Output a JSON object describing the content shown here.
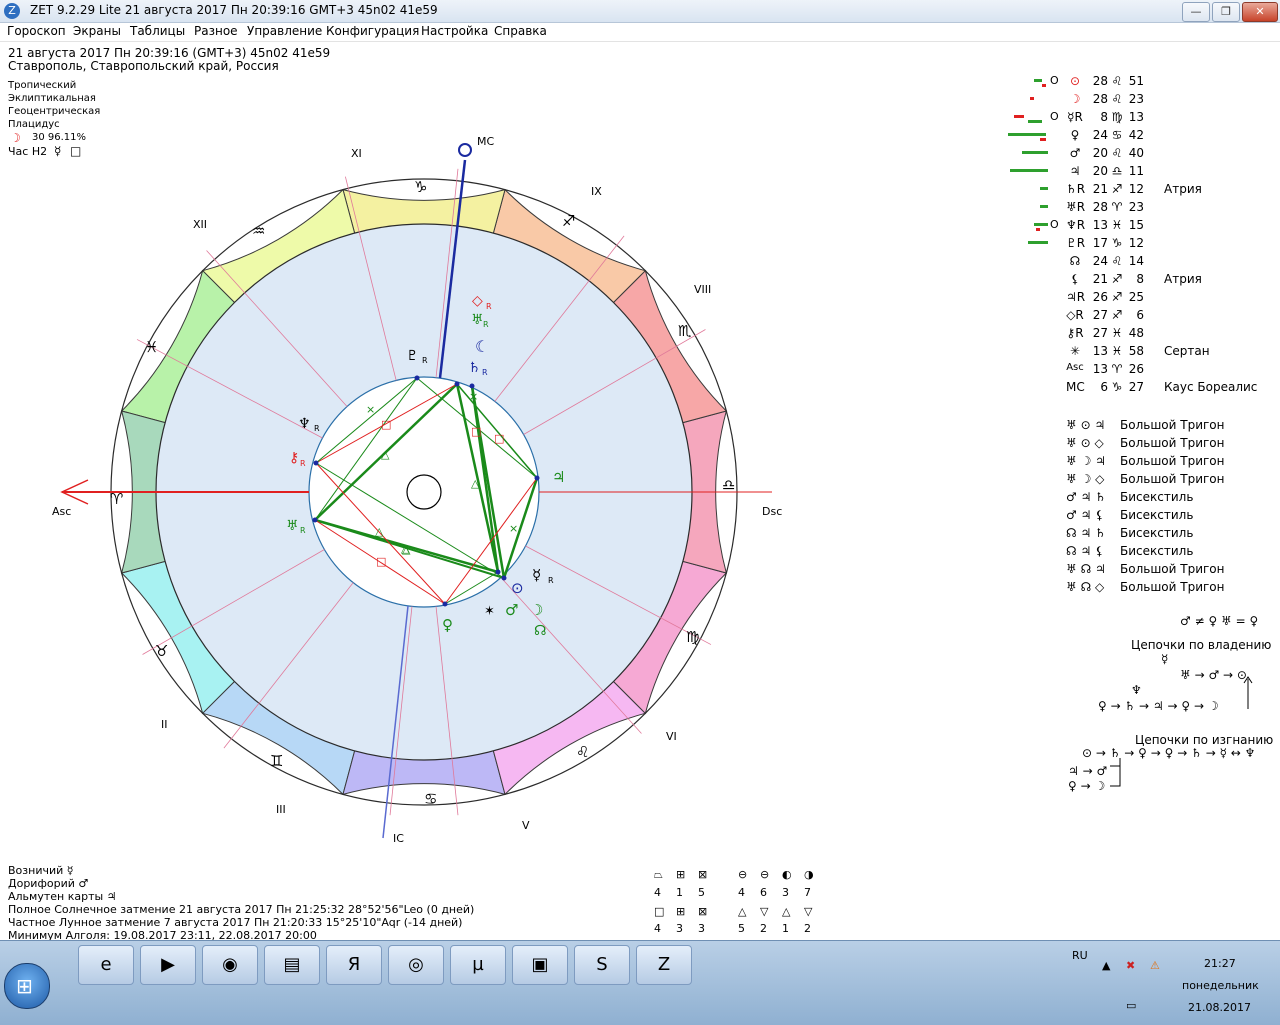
{
  "window": {
    "title": "ZET 9.2.29 Lite   21 августа 2017   Пн  20:39:16 GMT+3 45n02  41e59",
    "minimize": "—",
    "restore": "❐",
    "close": "✕"
  },
  "menu": [
    "Гороскоп",
    "Экраны",
    "Таблицы",
    "Разное",
    "Управление",
    "Конфигурация",
    "Настройка",
    "Справка"
  ],
  "header": {
    "datetime": "21 августа 2017  Пн  20:39:16 (GMT+3)  45n02  41e59",
    "place": "Ставрополь, Ставропольский край, Россия",
    "mode1": "Тропический",
    "mode2": "Эклиптикальная",
    "mode3": "Геоцентрическая",
    "mode4": "Плацидус",
    "moon_glyph": "☽",
    "moon_phase": "30 96.11%",
    "hour_label": "Час Н2",
    "hour_glyph": "☿",
    "hour_box": "□"
  },
  "chart": {
    "asc_label": "Asc",
    "dsc_label": "Dsc",
    "mc_label": "MC",
    "ic_label": "IC",
    "houses": [
      {
        "label": "XI"
      },
      {
        "label": "IX"
      },
      {
        "label": "XII"
      },
      {
        "label": "VIII"
      },
      {
        "label": "II"
      },
      {
        "label": "VI"
      },
      {
        "label": "III"
      },
      {
        "label": "V"
      }
    ],
    "signs": [
      {
        "glyph": "♑"
      },
      {
        "glyph": "♐"
      },
      {
        "glyph": "♏"
      },
      {
        "glyph": "♎"
      },
      {
        "glyph": "♍"
      },
      {
        "glyph": "♌"
      },
      {
        "glyph": "♋"
      },
      {
        "glyph": "♊"
      },
      {
        "glyph": "♉"
      },
      {
        "glyph": "♈"
      },
      {
        "glyph": "♓"
      },
      {
        "glyph": "♒"
      }
    ],
    "planets": [
      {
        "glyph": "◇",
        "sub": "R"
      },
      {
        "glyph": "♅",
        "sub": "R"
      },
      {
        "glyph": "☾",
        "sub": ""
      },
      {
        "glyph": "♄",
        "sub": "R"
      },
      {
        "glyph": "♇",
        "sub": "R"
      },
      {
        "glyph": "♆",
        "sub": "R"
      },
      {
        "glyph": "⚷",
        "sub": "R"
      },
      {
        "glyph": "♅",
        "sub": "R"
      },
      {
        "glyph": "♃",
        "sub": ""
      },
      {
        "glyph": "☿",
        "sub": "R"
      },
      {
        "glyph": "⊙",
        "sub": ""
      },
      {
        "glyph": "♂",
        "sub": ""
      },
      {
        "glyph": "✶",
        "sub": ""
      },
      {
        "glyph": "☽",
        "sub": ""
      },
      {
        "glyph": "☊",
        "sub": ""
      },
      {
        "glyph": "♀",
        "sub": ""
      }
    ],
    "inner_glyphs": [
      "×",
      "□",
      "△",
      "△",
      "△",
      "△",
      "×",
      "□",
      "□",
      "△",
      "×",
      "□"
    ]
  },
  "planet_table": [
    {
      "ring": "O",
      "glyph": "⊙",
      "deg": "28",
      "sign": "♌",
      "min": "51",
      "star": ""
    },
    {
      "ring": "",
      "glyph": "☽",
      "deg": "28",
      "sign": "♌",
      "min": "23",
      "star": ""
    },
    {
      "ring": "O",
      "glyph": "☿R",
      "deg": "8",
      "sign": "♍",
      "min": "13",
      "star": ""
    },
    {
      "ring": "",
      "glyph": "♀",
      "deg": "24",
      "sign": "♋",
      "min": "42",
      "star": ""
    },
    {
      "ring": "",
      "glyph": "♂",
      "deg": "20",
      "sign": "♌",
      "min": "40",
      "star": ""
    },
    {
      "ring": "",
      "glyph": "♃",
      "deg": "20",
      "sign": "♎",
      "min": "11",
      "star": ""
    },
    {
      "ring": "",
      "glyph": "♄R",
      "deg": "21",
      "sign": "♐",
      "min": "12",
      "star": "Атрия"
    },
    {
      "ring": "",
      "glyph": "♅R",
      "deg": "28",
      "sign": "♈",
      "min": "23",
      "star": ""
    },
    {
      "ring": "O",
      "glyph": "♆R",
      "deg": "13",
      "sign": "♓",
      "min": "15",
      "star": ""
    },
    {
      "ring": "",
      "glyph": "♇R",
      "deg": "17",
      "sign": "♑",
      "min": "12",
      "star": ""
    },
    {
      "ring": "",
      "glyph": "☊",
      "deg": "24",
      "sign": "♌",
      "min": "14",
      "star": ""
    },
    {
      "ring": "",
      "glyph": "⚸",
      "deg": "21",
      "sign": "♐",
      "min": "8",
      "star": "Атрия"
    },
    {
      "ring": "",
      "glyph": "♃R",
      "deg": "26",
      "sign": "♐",
      "min": "25",
      "star": ""
    },
    {
      "ring": "",
      "glyph": "◇R",
      "deg": "27",
      "sign": "♐",
      "min": "6",
      "star": ""
    },
    {
      "ring": "",
      "glyph": "⚷R",
      "deg": "27",
      "sign": "♓",
      "min": "48",
      "star": ""
    },
    {
      "ring": "",
      "glyph": "✳",
      "deg": "13",
      "sign": "♓",
      "min": "58",
      "star": "Сертан"
    },
    {
      "ring": "",
      "glyph": "Asc",
      "deg": "13",
      "sign": "♈",
      "min": "26",
      "star": ""
    },
    {
      "ring": "",
      "glyph": "MC",
      "deg": "6",
      "sign": "♑",
      "min": "27",
      "star": "Каус Бореалис"
    }
  ],
  "aspects": [
    {
      "glyphs": "♅ ⊙ ♃",
      "name": "Большой Тригон"
    },
    {
      "glyphs": "♅ ⊙ ◇",
      "name": "Большой Тригон"
    },
    {
      "glyphs": "♅ ☽ ♃",
      "name": "Большой Тригон"
    },
    {
      "glyphs": "♅ ☽ ◇",
      "name": "Большой Тригон"
    },
    {
      "glyphs": "♂ ♃ ♄",
      "name": "Бисекстиль"
    },
    {
      "glyphs": "♂ ♃ ⚸",
      "name": "Бисекстиль"
    },
    {
      "glyphs": "☊ ♃ ♄",
      "name": "Бисекстиль"
    },
    {
      "glyphs": "☊ ♃ ⚸",
      "name": "Бисекстиль"
    },
    {
      "glyphs": "♅ ☊ ♃",
      "name": "Большой Тригон"
    },
    {
      "glyphs": "♅ ☊ ◇",
      "name": "Большой Тригон"
    }
  ],
  "chains": {
    "equality": "♂ ≠ ♀ ♅ = ♀",
    "own_title": "Цепочки по владению",
    "own_top": "☿",
    "own_line1": "♅ → ♂ → ⊙",
    "own_psi": "♆",
    "own_line2": "♀ → ♄ → ♃ → ♀ → ☽",
    "exile_title": "Цепочки по изгнанию",
    "exile_line1": "⊙ → ♄ → ♀ → ♀ → ♄ → ☿ ↔ ♆",
    "exile_line2": "♃ → ♂",
    "exile_line3": "♀ → ☽"
  },
  "bottom_info": {
    "line1": "Возничий  ☿",
    "line2": "Дорифорий  ♂",
    "line3": "Альмутен карты  ♃",
    "line4": "Полное Солнечное затмение 21 августа 2017 Пн 21:25:32 28°52'56\"Leo (0 дней)",
    "line5": "Частное Лунное затмение 7 августа 2017 Пн 21:20:33 15°25'10\"Aqr (-14 дней)",
    "line6": "Минимум Алголя: 19.08.2017 23:11,  22.08.2017 20:00"
  },
  "stats": {
    "row1_syms": [
      "⏢",
      "⊞",
      "⊠",
      "⊖",
      "⊖",
      "◐",
      "◑"
    ],
    "row1_vals": [
      "4",
      "1",
      "5",
      "4",
      "6",
      "3",
      "7"
    ],
    "row2_syms": [
      "□",
      "⊞",
      "⊠",
      "△",
      "▽",
      "△",
      "▽"
    ],
    "row2_vals": [
      "4",
      "3",
      "3",
      "5",
      "2",
      "1",
      "2"
    ]
  },
  "taskbar": {
    "icons": [
      "e",
      "▶",
      "◉",
      "▤",
      "Я",
      "◎",
      "µ",
      "▣",
      "S",
      "Z"
    ],
    "lang": "RU",
    "tray1": "▲",
    "tray2": "✖",
    "tray3": "⚠",
    "time": "21:27",
    "day": "понедельник",
    "date": "21.08.2017",
    "start": "⊞"
  },
  "colors": {
    "red": "#e02020",
    "green": "#1a8a1a",
    "blue": "#1a2aa0",
    "wheel_bg": "#dde9f6"
  }
}
